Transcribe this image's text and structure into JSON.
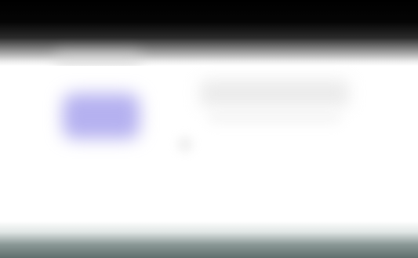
{
  "window": {
    "title": ""
  },
  "main": {
    "heading": "",
    "body_text": ""
  },
  "colors": {
    "accent": "#b5b1f0",
    "top_bar": "#000000",
    "bottom_bar": "#5f6f6d"
  }
}
